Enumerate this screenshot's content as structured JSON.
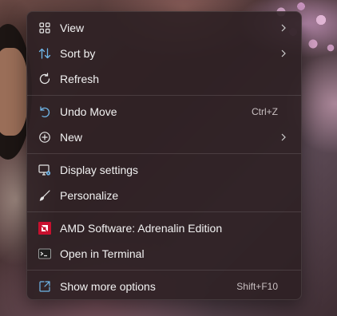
{
  "menu": {
    "items": [
      {
        "label": "View",
        "icon": "grid-icon"
      },
      {
        "label": "Sort by",
        "icon": "sort-arrows-icon"
      },
      {
        "label": "Refresh",
        "icon": "refresh-icon"
      },
      {
        "label": "Undo Move",
        "icon": "undo-icon",
        "shortcut": "Ctrl+Z"
      },
      {
        "label": "New",
        "icon": "plus-circle-icon"
      },
      {
        "label": "Display settings",
        "icon": "display-settings-icon"
      },
      {
        "label": "Personalize",
        "icon": "brush-icon"
      },
      {
        "label": "AMD Software: Adrenalin Edition",
        "icon": "amd-logo-icon"
      },
      {
        "label": "Open in Terminal",
        "icon": "terminal-icon"
      },
      {
        "label": "Show more options",
        "icon": "show-more-icon",
        "shortcut": "Shift+F10"
      }
    ]
  },
  "colors": {
    "menu_background": "#2e2024",
    "text": "#f2f2f2",
    "icon_accent": "#6fb6e8",
    "amd_red": "#c8102e"
  }
}
